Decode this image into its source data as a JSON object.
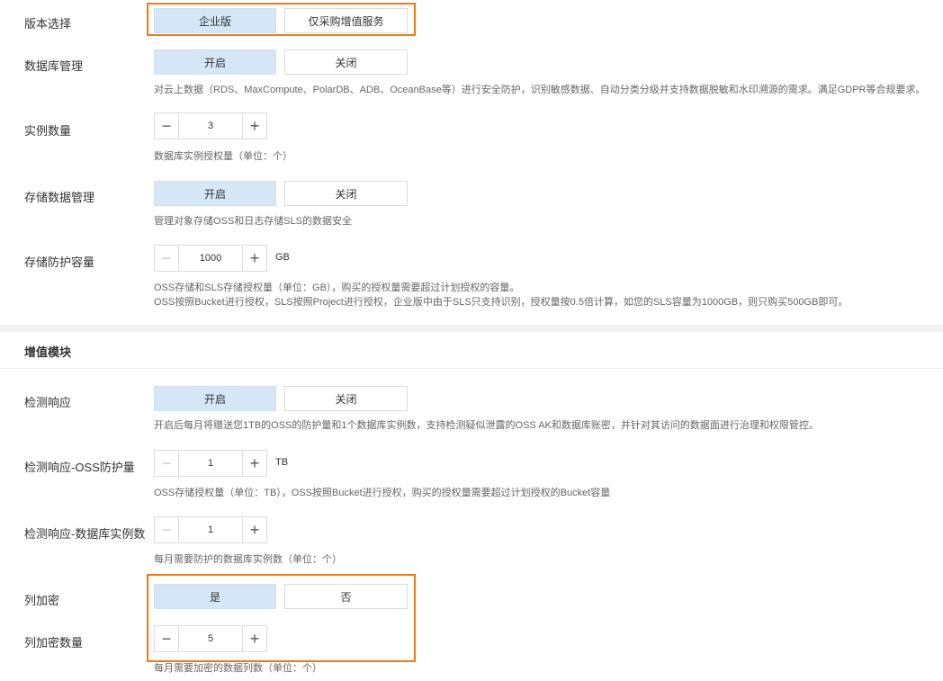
{
  "version": {
    "label": "版本选择",
    "options": [
      "企业版",
      "仅采购增值服务"
    ],
    "selected": "企业版"
  },
  "db_management": {
    "label": "数据库管理",
    "on": "开启",
    "off": "关闭",
    "desc": "对云上数据（RDS、MaxCompute、PolarDB、ADB、OceanBase等）进行安全防护，识别敏感数据、自动分类分级并支持数据脱敏和水印溯源的需求。满足GDPR等合规要求。"
  },
  "instance_count": {
    "label": "实例数量",
    "value": "3",
    "desc": "数据库实例授权量（单位：个）"
  },
  "storage_management": {
    "label": "存储数据管理",
    "on": "开启",
    "off": "关闭",
    "desc": "管理对象存储OSS和日志存储SLS的数据安全"
  },
  "storage_capacity": {
    "label": "存储防护容量",
    "value": "1000",
    "unit": "GB",
    "desc1": "OSS存储和SLS存储授权量（单位：GB），购买的授权量需要超过计划授权的容量。",
    "desc2": "OSS按照Bucket进行授权，SLS按照Project进行授权，企业版中由于SLS只支持识别，授权量按0.5倍计算，如您的SLS容量为1000GB，则只购买500GB即可。"
  },
  "addon": {
    "title": "增值模块"
  },
  "detect_response": {
    "label": "检测响应",
    "on": "开启",
    "off": "关闭",
    "desc": "开启后每月将赠送您1TB的OSS的防护量和1个数据库实例数，支持检测疑似泄露的OSS AK和数据库账密，并针对其访问的数据面进行治理和权限管控。"
  },
  "detect_oss": {
    "label": "检测响应-OSS防护量",
    "value": "1",
    "unit": "TB",
    "desc": "OSS存储授权量（单位：TB），OSS按照Bucket进行授权，购买的授权量需要超过计划授权的Bucket容量"
  },
  "detect_db": {
    "label": "检测响应-数据库实例数",
    "value": "1",
    "desc": "每月需要防护的数据库实例数（单位：个）"
  },
  "column_encrypt": {
    "label": "列加密",
    "yes": "是",
    "no": "否"
  },
  "column_encrypt_count": {
    "label": "列加密数量",
    "value": "5",
    "desc": "每月需要加密的数据列数（单位：个）"
  },
  "icons": {
    "minus": "−",
    "plus": "+"
  },
  "colors": {
    "active_bg": "#d5e7f7",
    "highlight": "#ef7a14"
  }
}
